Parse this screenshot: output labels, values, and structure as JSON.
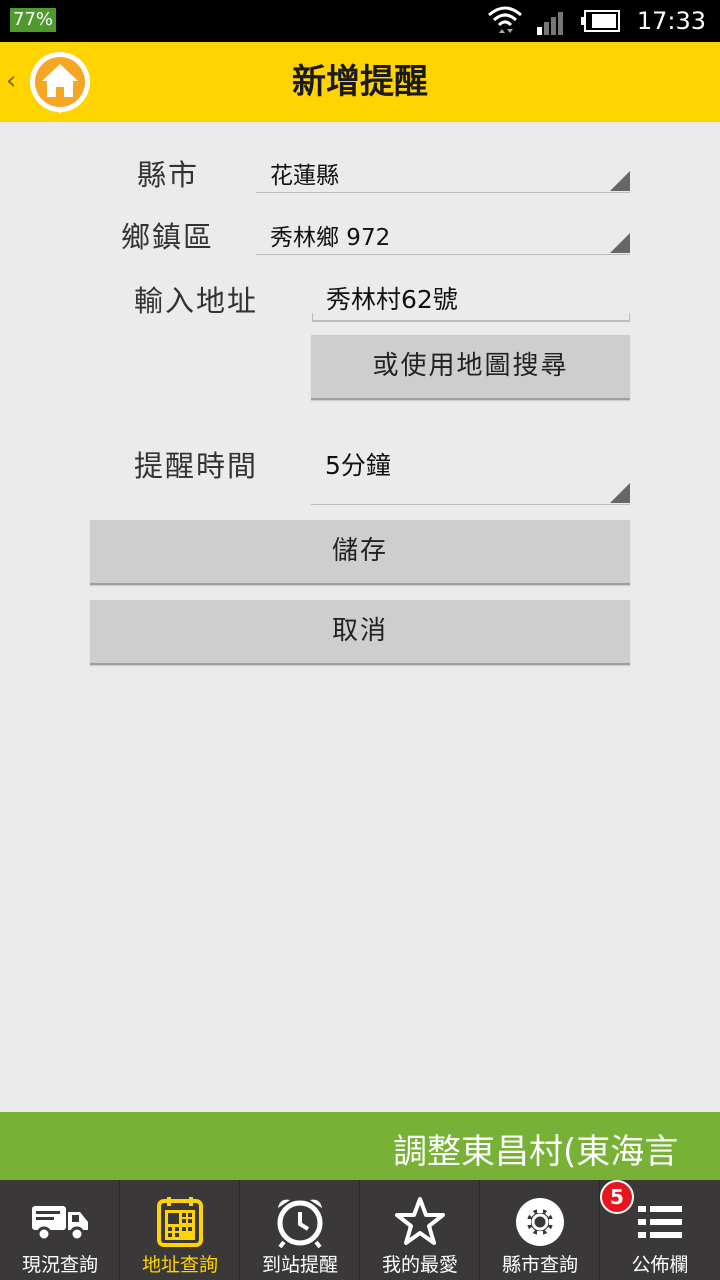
{
  "status_bar": {
    "battery": "77%",
    "time": "17:33"
  },
  "header": {
    "title": "新增提醒"
  },
  "form": {
    "city_label": "縣市",
    "city_value": "花蓮縣",
    "district_label": "鄉鎮區",
    "district_value": "秀林鄉 972",
    "address_label": "輸入地址",
    "address_value": "秀林村62號",
    "map_search_button": "或使用地圖搜尋",
    "reminder_time_label": "提醒時間",
    "reminder_time_value": "5分鐘",
    "save_button": "儲存",
    "cancel_button": "取消"
  },
  "marquee": {
    "text": "調整東昌村(東海言"
  },
  "bottom_nav": {
    "items": [
      {
        "label": "現況查詢",
        "icon": "truck-icon"
      },
      {
        "label": "地址查詢",
        "icon": "calendar-grid-icon",
        "active": true
      },
      {
        "label": "到站提醒",
        "icon": "alarm-clock-icon"
      },
      {
        "label": "我的最愛",
        "icon": "star-icon"
      },
      {
        "label": "縣市查詢",
        "icon": "gear-icon"
      },
      {
        "label": "公佈欄",
        "icon": "list-icon",
        "badge": "5"
      }
    ]
  },
  "colors": {
    "header": "#ffd400",
    "marquee": "#77b136",
    "nav_bg": "#3a3838",
    "active": "#ffd400",
    "badge": "#e8141e"
  }
}
